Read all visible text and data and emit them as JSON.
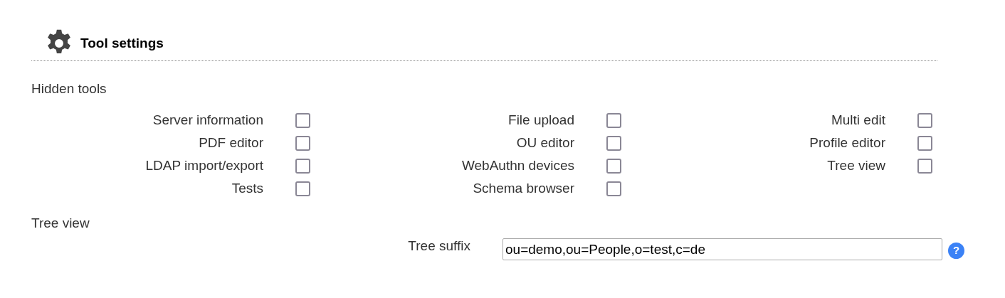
{
  "header": {
    "title": "Tool settings"
  },
  "hidden_tools": {
    "heading": "Hidden tools",
    "columns": [
      {
        "items": [
          {
            "label": "Server information",
            "checked": false
          },
          {
            "label": "PDF editor",
            "checked": false
          },
          {
            "label": "LDAP import/export",
            "checked": false
          },
          {
            "label": "Tests",
            "checked": false
          }
        ]
      },
      {
        "items": [
          {
            "label": "File upload",
            "checked": false
          },
          {
            "label": "OU editor",
            "checked": false
          },
          {
            "label": "WebAuthn devices",
            "checked": false
          },
          {
            "label": "Schema browser",
            "checked": false
          }
        ]
      },
      {
        "items": [
          {
            "label": "Multi edit",
            "checked": false
          },
          {
            "label": "Profile editor",
            "checked": false
          },
          {
            "label": "Tree view",
            "checked": false
          }
        ]
      }
    ]
  },
  "tree_view": {
    "heading": "Tree view",
    "fields": [
      {
        "label": "Tree suffix",
        "value": "ou=demo,ou=People,o=test,c=de",
        "help": "?"
      }
    ]
  }
}
